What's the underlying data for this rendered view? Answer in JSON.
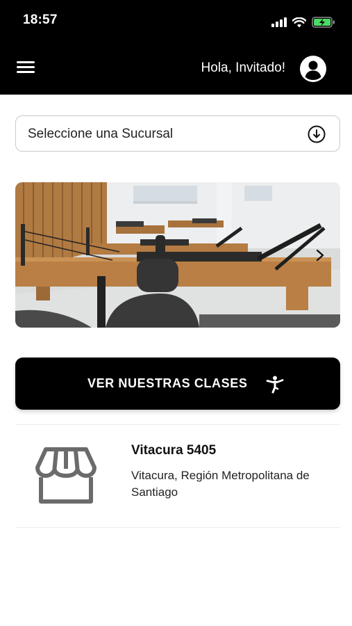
{
  "status_bar": {
    "time": "18:57",
    "icons": [
      "cellular-signal-icon",
      "wifi-icon",
      "battery-charging-icon"
    ]
  },
  "header": {
    "menu_icon": "hamburger-menu-icon",
    "greeting": "Hola, Invitado!",
    "avatar_icon": "user-avatar-icon"
  },
  "branch_selector": {
    "label": "Seleccione una Sucursal",
    "icon": "download-circle-icon"
  },
  "carousel": {
    "image": "pilates-reformer-studio-photo",
    "next_icon": "chevron-right-icon"
  },
  "classes_button": {
    "label": "VER NUESTRAS CLASES",
    "icon": "yoga-pose-icon"
  },
  "branch_list": [
    {
      "name": "Vitacura 5405",
      "address": "Vitacura, Región Metropolitana de Santiago",
      "icon": "store-icon"
    }
  ],
  "colors": {
    "header_bg": "#000000",
    "button_bg": "#000000",
    "icon_gray": "#6b6b6b",
    "battery_green": "#4cd964"
  }
}
